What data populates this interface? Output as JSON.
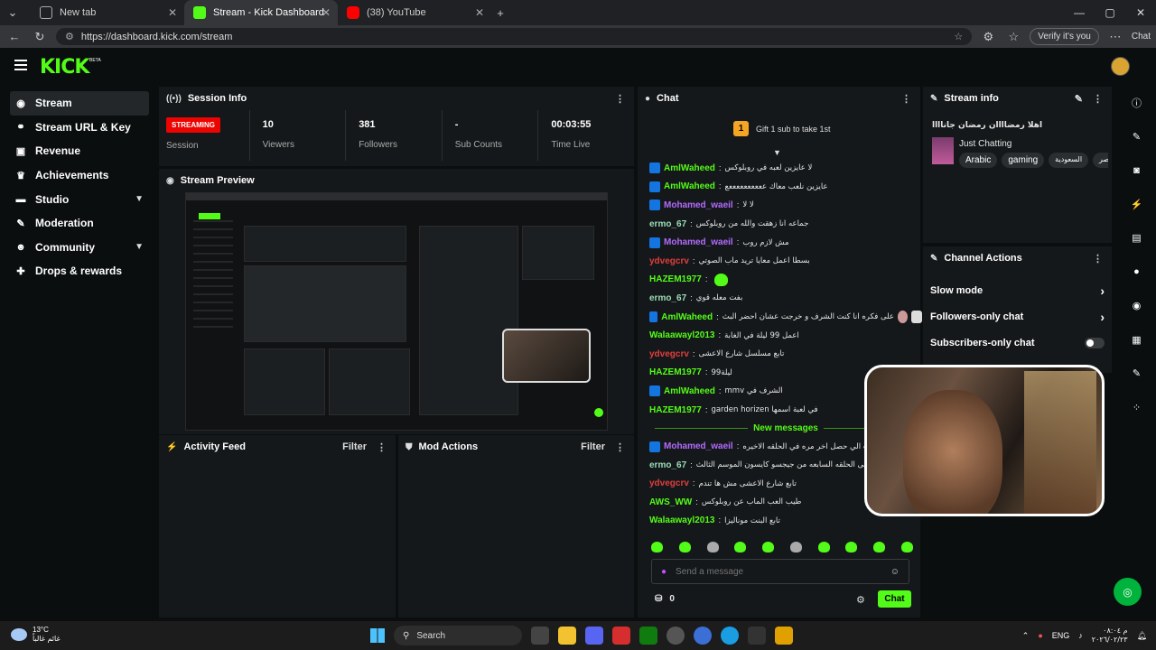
{
  "browser": {
    "tabs": [
      {
        "label": "New tab",
        "active": false
      },
      {
        "label": "Stream - Kick Dashboard",
        "active": true
      },
      {
        "label": "(38) YouTube",
        "active": false
      }
    ],
    "url": "https://dashboard.kick.com/stream",
    "verify_label": "Verify it's you",
    "chat_label": "Chat"
  },
  "header": {
    "logo": "KICK",
    "beta": "BETA"
  },
  "sidebar": {
    "items": [
      {
        "label": "Stream",
        "icon": "broadcast-icon",
        "glyph": "((•))",
        "active": true
      },
      {
        "label": "Stream URL & Key",
        "icon": "link-icon",
        "glyph": "⚲"
      },
      {
        "label": "Revenue",
        "icon": "revenue-icon",
        "glyph": "▣"
      },
      {
        "label": "Achievements",
        "icon": "trophy-icon",
        "glyph": "♛"
      },
      {
        "label": "Studio",
        "icon": "studio-icon",
        "glyph": "▬",
        "expandable": true
      },
      {
        "label": "Moderation",
        "icon": "wrench-icon",
        "glyph": "✎"
      },
      {
        "label": "Community",
        "icon": "people-icon",
        "glyph": "☻",
        "expandable": true
      },
      {
        "label": "Drops & rewards",
        "icon": "gift-icon",
        "glyph": "✚"
      }
    ]
  },
  "session": {
    "title": "Session Info",
    "status": "STREAMING",
    "status_label": "Session",
    "stats": [
      {
        "value": "10",
        "label": "Viewers"
      },
      {
        "value": "381",
        "label": "Followers"
      },
      {
        "value": "-",
        "label": "Sub Counts"
      },
      {
        "value": "00:03:55",
        "label": "Time Live"
      }
    ]
  },
  "preview": {
    "title": "Stream Preview"
  },
  "activity": {
    "title": "Activity Feed",
    "filter": "Filter"
  },
  "mod": {
    "title": "Mod Actions",
    "filter": "Filter"
  },
  "chat": {
    "title": "Chat",
    "gift_count": "1",
    "gift_text": "Gift 1 sub to take 1st",
    "messages": [
      {
        "user": "AmlWaheed",
        "color": "#53fc18",
        "badge": true,
        "text": "لا عايزين لعبه في روبلوكس"
      },
      {
        "user": "AmlWaheed",
        "color": "#53fc18",
        "badge": true,
        "text": "عايزين نلعب معاك ععععععععععع"
      },
      {
        "user": "Mohamed_waeil",
        "color": "#b36bff",
        "badge": true,
        "text": "لا لا"
      },
      {
        "user": "ermo_67",
        "color": "#9adbb7",
        "badge": false,
        "text": "جماعه انا زهقت والله من روبلوكس"
      },
      {
        "user": "Mohamed_waeil",
        "color": "#b36bff",
        "badge": true,
        "text": "مش لازم روب"
      },
      {
        "user": "ydvegcrv",
        "color": "#e03e3e",
        "badge": false,
        "text": "بسطا اعمل معايا تريد ماب الصوتي"
      },
      {
        "user": "HAZEM1977",
        "color": "#53fc18",
        "badge": false,
        "text": "",
        "emote": true
      },
      {
        "user": "ermo_67",
        "color": "#9adbb7",
        "badge": false,
        "text": "بفت معله قوي"
      },
      {
        "user": "AmlWaheed",
        "color": "#53fc18",
        "badge": true,
        "text": "على فكره انا كنت الشرف و خرجت عشان احضر البث"
      },
      {
        "user": "Walaawayl2013",
        "color": "#53fc18",
        "badge": false,
        "text": "اعمل 99 ليلة في الغابة"
      },
      {
        "user": "ydvegcrv",
        "color": "#e03e3e",
        "badge": false,
        "text": "تابع مسلسل شارع الاعشى"
      },
      {
        "user": "HAZEM1977",
        "color": "#53fc18",
        "badge": false,
        "text": "99ليلة"
      },
      {
        "user": "AmlWaheed",
        "color": "#53fc18",
        "badge": true,
        "text": "mmv الشرف في"
      },
      {
        "user": "HAZEM1977",
        "color": "#53fc18",
        "badge": false,
        "text": "garden horizen في لعبة اسمها"
      }
    ],
    "new_messages_label": "New messages",
    "new_messages": [
      {
        "user": "Mohamed_waeil",
        "color": "#b36bff",
        "badge": true,
        "text": "شفت الي حصل اخر مره في الحلقه الاخيره"
      },
      {
        "user": "ermo_67",
        "color": "#9adbb7",
        "badge": false,
        "text": "انا قاعد بتفرج على الحلقه السابعه من جيجسو كايسون الموسم الثالث"
      },
      {
        "user": "ydvegcrv",
        "color": "#e03e3e",
        "badge": false,
        "text": "تابع شارع الاعشى مش ها تندم"
      },
      {
        "user": "AWS_WW",
        "color": "#53fc18",
        "badge": false,
        "text": "طيب العب الماب عن روبلوكس"
      },
      {
        "user": "Walaawayl2013",
        "color": "#53fc18",
        "badge": false,
        "text": "تابع البنت موناليزا"
      }
    ],
    "input_placeholder": "Send a message",
    "points": "0",
    "send_label": "Chat"
  },
  "stream_info": {
    "title": "Stream info",
    "stream_title": "اهلا رمضاااان رمضان جاناااا",
    "category": "Just Chatting",
    "tags": [
      "Arabic",
      "gaming",
      "السعودية",
      "مصر"
    ]
  },
  "channel_actions": {
    "title": "Channel Actions",
    "items": [
      {
        "label": "Slow mode",
        "kind": "arrow"
      },
      {
        "label": "Followers-only chat",
        "kind": "arrow"
      },
      {
        "label": "Subscribers-only chat",
        "kind": "toggle"
      }
    ]
  },
  "taskbar": {
    "temp": "13°C",
    "weather_text": "غائم غالباً",
    "search": "Search",
    "lang": "ENG",
    "time": "م ٠٨:٠٤",
    "date": "٢٠٢٦/٠٢/٢٣"
  },
  "colors": {
    "accent": "#53fc18",
    "live": "#eb0400",
    "panel": "#15181a",
    "bg": "#0b0e0f"
  }
}
